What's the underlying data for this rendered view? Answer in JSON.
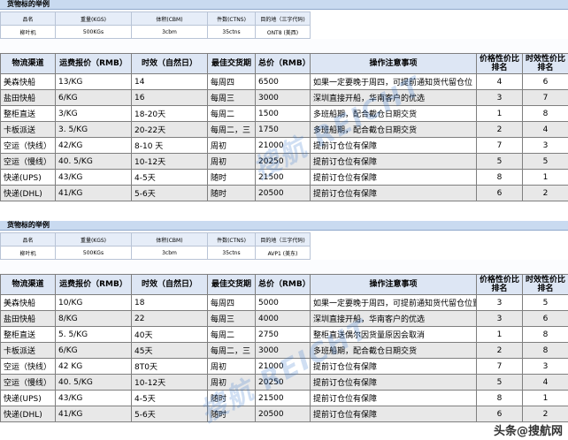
{
  "section1": {
    "title": "货物标的举例",
    "info_headers": [
      "品名",
      "重量(KGS)",
      "体积(CBM)",
      "件数(CTNS)",
      "目的地（三字代码)"
    ],
    "info_values": [
      "柳叶机",
      "500KGs",
      "3cbm",
      "35ctns",
      "ONT8 (美西)"
    ],
    "table_headers": [
      "物流渠道",
      "运费报价（RMB）",
      "时效（自然日）",
      "最佳交货期",
      "总价（RMB）",
      "操作注意事项",
      "价格性价比排名",
      "时效性价比排名"
    ],
    "rows": [
      [
        "美森快船",
        "13/KG",
        "14",
        "每周四",
        "6500",
        "如果一定要晚于周四，可提前通知货代留仓位",
        "4",
        "6"
      ],
      [
        "盐田快船",
        "6/KG",
        "16",
        "每周三",
        "3000",
        "深圳直接开船，华南客户的优选",
        "3",
        "7"
      ],
      [
        "整柜直送",
        "3/KG",
        "18-20天",
        "每周二",
        "1500",
        "多班船期，配合截仓日期交货",
        "1",
        "8"
      ],
      [
        "卡板派送",
        "3. 5/KG",
        "20-22天",
        "每周二，三",
        "1750",
        "多班船期，配合截仓日期交货",
        "2",
        "4"
      ],
      [
        "空运（快线）",
        "42/KG",
        "8-10 天",
        "周初",
        "21000",
        "提前订仓位有保障",
        "7",
        "3"
      ],
      [
        "空运（慢线）",
        "40. 5/KG",
        "10-12天",
        "周初",
        "20250",
        "提前订仓位有保障",
        "5",
        "5"
      ],
      [
        "快递(UPS)",
        "43/KG",
        "4-5天",
        "随时",
        "21500",
        "提前订仓位有保障",
        "8",
        "1"
      ],
      [
        "快递(DHL)",
        "41/KG",
        "5-6天",
        "随时",
        "20500",
        "提前订仓位有保障",
        "6",
        "2"
      ]
    ]
  },
  "section2": {
    "title": "货物标的举例",
    "info_headers": [
      "品名",
      "重量(KGS)",
      "体积(CBM)",
      "件数(CTNS)",
      "目的地（三字代码)"
    ],
    "info_values": [
      "柳叶机",
      "500KGs",
      "3cbm",
      "35ctns",
      "AVP1 (美东)"
    ],
    "table_headers": [
      "物流渠道",
      "运费报价（RMB）",
      "时效（自然日）",
      "最佳交货期",
      "总价（RMB）",
      "操作注意事项",
      "价格性价比排名",
      "时效性价比排名"
    ],
    "rows": [
      [
        "美森快船",
        "10/KG",
        "18",
        "每周四",
        "5000",
        "如果一定要晚于周四，可提前通知货代留仓位置",
        "3",
        "5"
      ],
      [
        "盐田快船",
        "8/KG",
        "22",
        "每周三",
        "4000",
        "深圳直接开船，华南客户的优选",
        "3",
        "6"
      ],
      [
        "整柜直送",
        "5. 5/KG",
        "40天",
        "每周二",
        "2750",
        "整柜直送偶尔因货量原因会取消",
        "1",
        "8"
      ],
      [
        "卡板派送",
        "6/KG",
        "45天",
        "每周二，三",
        "3000",
        "多班船期，配合截仓日期交货",
        "2",
        "8"
      ],
      [
        "空运（快线）",
        "42 KG",
        "8T0天",
        "周初",
        "21000",
        "提前订仓位有保障",
        "7",
        "3"
      ],
      [
        "空运（慢线）",
        "40. 5/KG",
        "10-12天",
        "周初",
        "20250",
        "提前订仓位有保障",
        "5",
        "4"
      ],
      [
        "快递(UPS)",
        "43/KG",
        "4-5天",
        "随时",
        "21500",
        "提前订仓位有保障",
        "8",
        "1"
      ],
      [
        "快递(DHL)",
        "41/KG",
        "5-6天",
        "随时",
        "20500",
        "提前订仓位有保障",
        "6",
        "2"
      ]
    ]
  },
  "watermark_text": "搜航 REICHT",
  "footer_text": "头条@搜航网"
}
